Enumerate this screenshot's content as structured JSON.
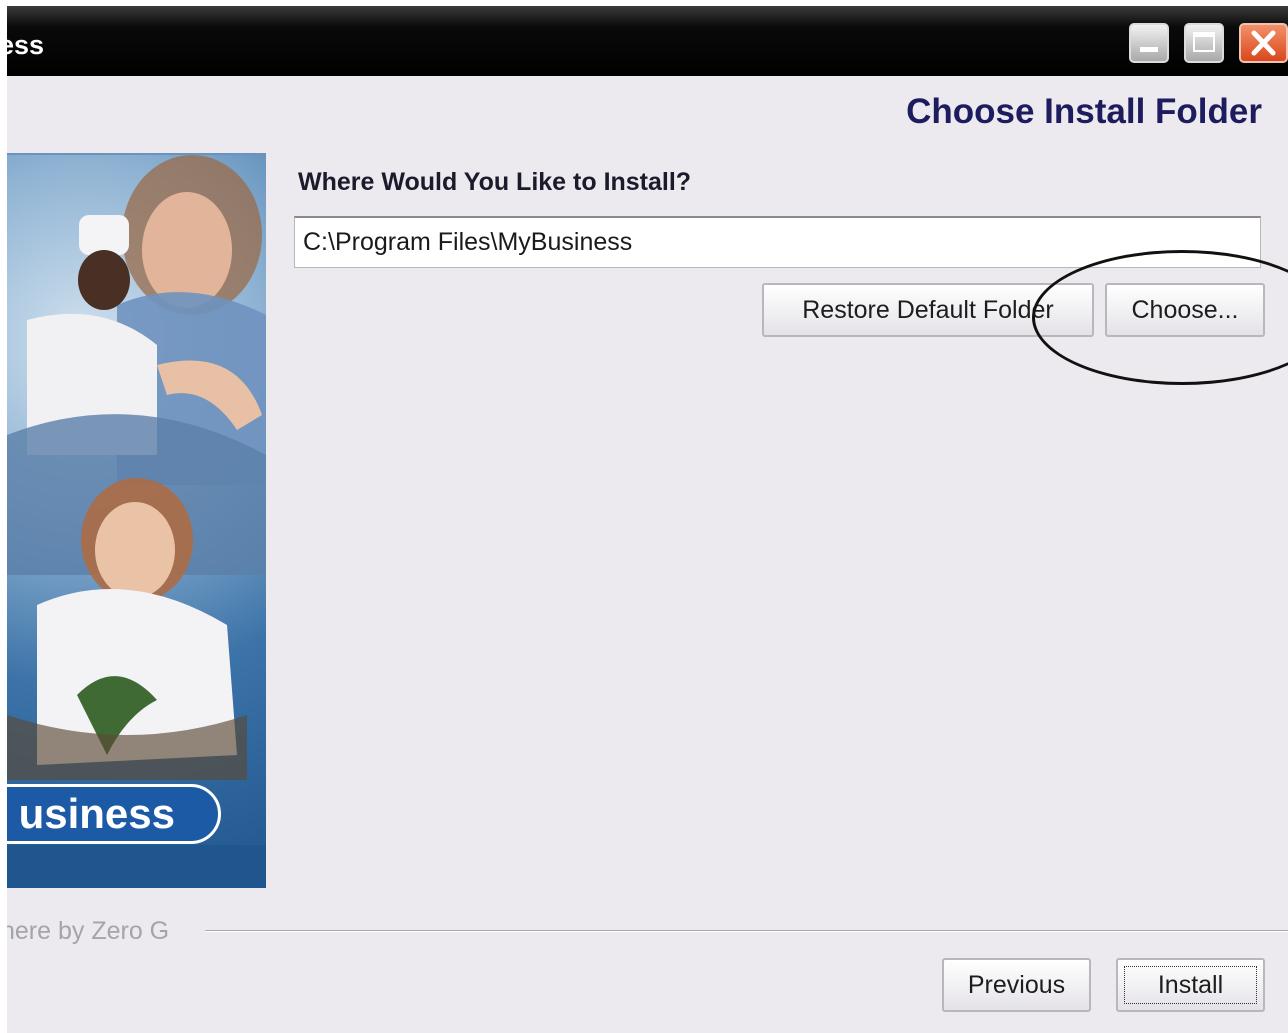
{
  "window": {
    "title": "ess"
  },
  "titlebar": {
    "minimize_icon": "minimize-icon",
    "maximize_icon": "maximize-icon",
    "close_icon": "close-icon"
  },
  "page": {
    "heading": "Choose Install Folder"
  },
  "side_panel": {
    "brand_text": "usiness"
  },
  "install_location": {
    "question": "Where Would You Like to Install?",
    "path_value": "C:\\Program Files\\MyBusiness"
  },
  "buttons": {
    "restore_default": "Restore Default Folder",
    "choose": "Choose...",
    "previous": "Previous",
    "install": "Install"
  },
  "footer": {
    "credit": "here by Zero G"
  },
  "colors": {
    "heading": "#1c1c5e",
    "window_bg": "#ece9ef",
    "titlebar": "#000000",
    "close_button": "#e05a2c",
    "brand_pill": "#1d5aa6"
  }
}
